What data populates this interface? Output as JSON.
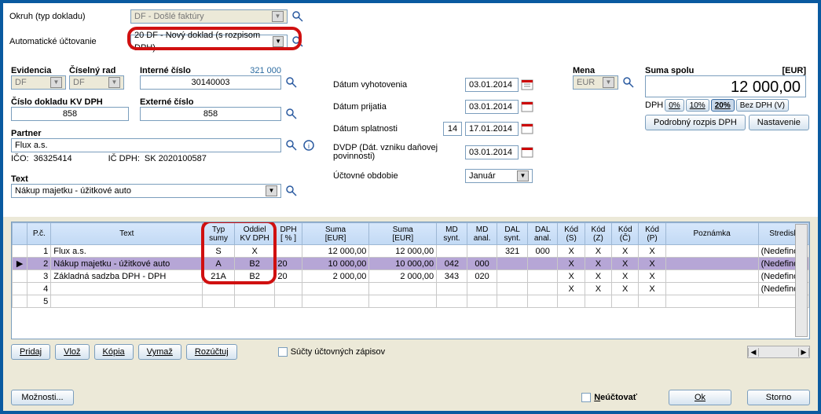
{
  "top": {
    "okruh_label": "Okruh (typ dokladu)",
    "okruh_value": "DF - Došlé faktúry",
    "auto_label": "Automatické účtovanie",
    "auto_value": "20 DF - Nový doklad (s rozpisom DPH)"
  },
  "fields": {
    "evidencia_lbl": "Evidencia",
    "evidencia_val": "DF",
    "ciselny_lbl": "Číselný rad",
    "ciselny_val": "DF",
    "interne_lbl": "Interné číslo",
    "interne_badge": "321 000",
    "interne_val": "30140003",
    "kvdph_lbl": "Číslo dokladu KV DPH",
    "kvdph_val": "858",
    "externe_lbl": "Externé číslo",
    "externe_val": "858",
    "partner_lbl": "Partner",
    "partner_val": "Flux a.s.",
    "ico_lbl": "IČO:",
    "ico_val": "36325414",
    "icdph_lbl": "IČ DPH:",
    "icdph_val": "SK 2020100587",
    "text_lbl": "Text",
    "text_val": "Nákup majetku - úžitkové auto",
    "d_vyhot_lbl": "Dátum vyhotovenia",
    "d_vyhot_val": "03.01.2014",
    "d_prij_lbl": "Dátum prijatia",
    "d_prij_val": "03.01.2014",
    "d_splat_lbl": "Dátum splatnosti",
    "d_splat_days": "14",
    "d_splat_val": "17.01.2014",
    "dvdp_lbl": "DVDP (Dát. vzniku daňovej povinnosti)",
    "dvdp_val": "03.01.2014",
    "obdobie_lbl": "Účtovné obdobie",
    "obdobie_val": "Január",
    "mena_lbl": "Mena",
    "mena_val": "EUR",
    "suma_lbl": "Suma spolu",
    "suma_unit": "[EUR]",
    "suma_val": "12 000,00",
    "dph_lbl": "DPH",
    "btn_0": "0%",
    "btn_10": "10%",
    "btn_20": "20%",
    "btn_bez": "Bez DPH (V)",
    "btn_rozpis": "Podrobný rozpis DPH",
    "btn_nast": "Nastavenie"
  },
  "grid": {
    "headers": [
      "",
      "P.č.",
      "Text",
      "Typ sumy",
      "Oddiel KV DPH",
      "DPH [ % ]",
      "Suma [EUR]",
      "Suma [EUR]",
      "MD synt.",
      "MD anal.",
      "DAL synt.",
      "DAL anal.",
      "Kód (S)",
      "Kód (Z)",
      "Kód (Č)",
      "Kód (P)",
      "Poznámka",
      "Stredisk"
    ],
    "rows": [
      {
        "ptr": "",
        "pc": "1",
        "text": "Flux a.s.",
        "typ": "S",
        "odd": "X",
        "dph": "",
        "s1": "12 000,00",
        "s2": "12 000,00",
        "mds": "",
        "mda": "",
        "dals": "321",
        "dala": "000",
        "ks": "X",
        "kz": "X",
        "kc": "X",
        "kp": "X",
        "p": "",
        "str": "(Nedefino"
      },
      {
        "ptr": "▶",
        "pc": "2",
        "text": "Nákup majetku - úžitkové auto",
        "typ": "A",
        "odd": "B2",
        "dph": "20",
        "s1": "10 000,00",
        "s2": "10 000,00",
        "mds": "042",
        "mda": "000",
        "dals": "",
        "dala": "",
        "ks": "X",
        "kz": "X",
        "kc": "X",
        "kp": "X",
        "p": "",
        "str": "(Nedefino"
      },
      {
        "ptr": "",
        "pc": "3",
        "text": "Základná sadzba DPH - DPH",
        "typ": "21A",
        "odd": "B2",
        "dph": "20",
        "s1": "2 000,00",
        "s2": "2 000,00",
        "mds": "343",
        "mda": "020",
        "dals": "",
        "dala": "",
        "ks": "X",
        "kz": "X",
        "kc": "X",
        "kp": "X",
        "p": "",
        "str": "(Nedefino"
      },
      {
        "ptr": "",
        "pc": "4",
        "text": "",
        "typ": "",
        "odd": "",
        "dph": "",
        "s1": "",
        "s2": "",
        "mds": "",
        "mda": "",
        "dals": "",
        "dala": "",
        "ks": "X",
        "kz": "X",
        "kc": "X",
        "kp": "X",
        "p": "",
        "str": "(Nedefino"
      },
      {
        "ptr": "",
        "pc": "5",
        "text": "",
        "typ": "",
        "odd": "",
        "dph": "",
        "s1": "",
        "s2": "",
        "mds": "",
        "mda": "",
        "dals": "",
        "dala": "",
        "ks": "",
        "kz": "",
        "kc": "",
        "kp": "",
        "p": "",
        "str": ""
      }
    ]
  },
  "buttons": {
    "pridaj": "Pridaj",
    "vloz": "Vlož",
    "kopia": "Kópia",
    "vymaz": "Vymaž",
    "rozuctuj": "Rozúčtuj",
    "sucty": "Súčty účtovných zápisov",
    "moznosti": "Možnosti...",
    "neuct": "Neúčtovať",
    "ok": "Ok",
    "storno": "Storno"
  }
}
